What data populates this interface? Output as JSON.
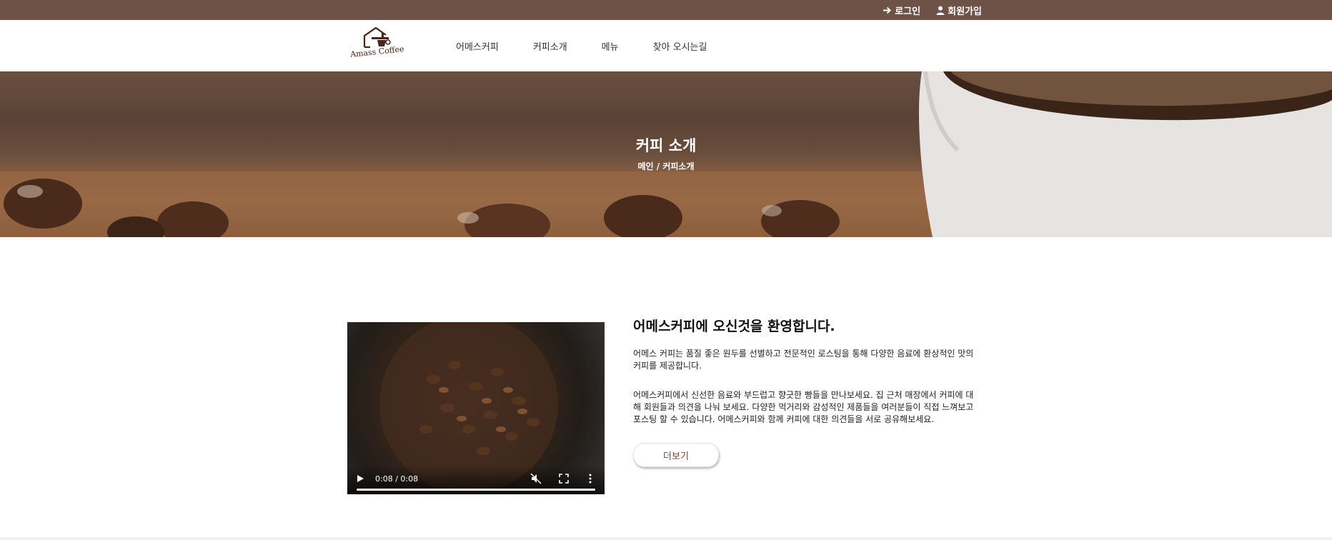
{
  "colors": {
    "topbar": "#6e5248",
    "accent": "#7a4a36"
  },
  "topbar": {
    "login": {
      "icon": "arrow-right-icon",
      "label": "로그인"
    },
    "signup": {
      "icon": "user-icon",
      "label": "회원가입"
    }
  },
  "header": {
    "logo_text": "Amass Coffee",
    "nav": [
      "어메스커피",
      "커피소개",
      "메뉴",
      "찾아 오시는길"
    ]
  },
  "hero": {
    "title": "커피 소개",
    "breadcrumb": "메인 / 커피소개"
  },
  "video": {
    "time": "0:08 / 0:08",
    "progress": 1.0,
    "muted": true
  },
  "content": {
    "title": "어메스커피에 오신것을 환영합니다.",
    "paragraph1": "어메스 커피는 품질 좋은 원두를 선별하고 전문적인 로스팅을 통해 다양한 음료에 환상적인 맛의 커피를 제공합니다.",
    "paragraph2": "어메스커피에서 신선한 음료와 부드럽고 향긋한 빵들을 만나보세요. 집 근처 매장에서 커피에 대해 회원들과 의견을 나눠 보세요. 다양한 먹거리와 감성적인 제품들을 여러분들이 직접 느껴보고 포스팅 할 수 있습니다. 어메스커피와 함께 커피에 대한 의견들을 서로 공유해보세요.",
    "more_button": "더보기"
  }
}
